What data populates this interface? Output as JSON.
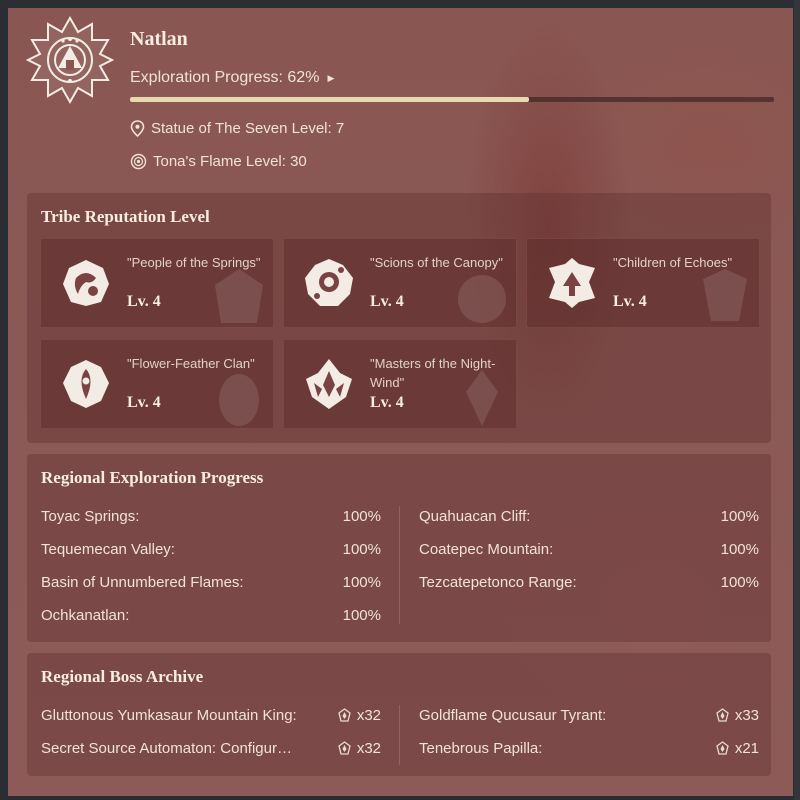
{
  "region": {
    "name": "Natlan",
    "exploration_label": "Exploration Progress: 62%",
    "exploration_progress_percent": 62,
    "statue_label": "Statue of The Seven Level: 7",
    "flame_label": "Tona's Flame Level: 30"
  },
  "tribes": {
    "title": "Tribe Reputation Level",
    "items": [
      {
        "name": "\"People of the Springs\"",
        "level": "Lv. 4",
        "icon": "springs-tribe-icon"
      },
      {
        "name": "\"Scions of the Canopy\"",
        "level": "Lv. 4",
        "icon": "canopy-tribe-icon"
      },
      {
        "name": "\"Children of Echoes\"",
        "level": "Lv. 4",
        "icon": "echoes-tribe-icon"
      },
      {
        "name": "\"Flower-Feather Clan\"",
        "level": "Lv. 4",
        "icon": "flower-feather-tribe-icon"
      },
      {
        "name": "\"Masters of the Night-Wind\"",
        "level": "Lv. 4",
        "icon": "night-wind-tribe-icon"
      }
    ]
  },
  "exploration": {
    "title": "Regional Exploration Progress",
    "left": [
      {
        "area": "Toyac Springs:",
        "value": "100%"
      },
      {
        "area": "Tequemecan Valley:",
        "value": "100%"
      },
      {
        "area": "Basin of Unnumbered Flames:",
        "value": "100%"
      },
      {
        "area": "Ochkanatlan:",
        "value": "100%"
      }
    ],
    "right": [
      {
        "area": "Quahuacan Cliff:",
        "value": "100%"
      },
      {
        "area": "Coatepec Mountain:",
        "value": "100%"
      },
      {
        "area": "Tezcatepetonco Range:",
        "value": "100%"
      }
    ]
  },
  "bosses": {
    "title": "Regional Boss Archive",
    "left": [
      {
        "name": "Gluttonous Yumkasaur Mountain King:",
        "count": "x32"
      },
      {
        "name": "Secret Source Automaton: Configur…",
        "count": "x32"
      }
    ],
    "right": [
      {
        "name": "Goldflame Qucusaur Tyrant:",
        "count": "x33"
      },
      {
        "name": "Tenebrous Papilla:",
        "count": "x21"
      }
    ]
  },
  "colors": {
    "accent_bar": "#e8d9ae",
    "panel_bg": "#623232",
    "text": "#f0e3d6"
  }
}
